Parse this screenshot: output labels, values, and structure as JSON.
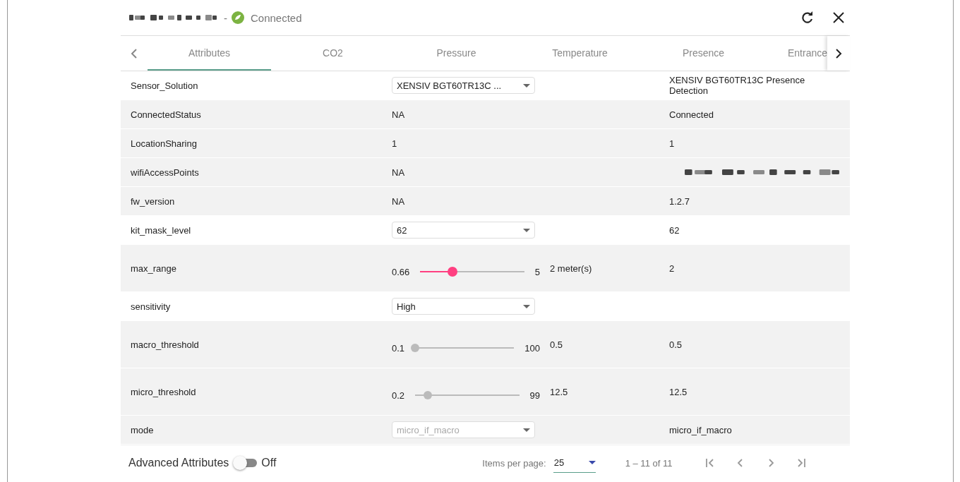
{
  "header": {
    "status": "Connected",
    "separator": "-"
  },
  "tabs": [
    {
      "label": "Attributes",
      "selected": true
    },
    {
      "label": "CO2",
      "selected": false
    },
    {
      "label": "Pressure",
      "selected": false
    },
    {
      "label": "Temperature",
      "selected": false
    },
    {
      "label": "Presence",
      "selected": false
    },
    {
      "label": "Entrance",
      "selected": false
    }
  ],
  "rows": [
    {
      "name": "Sensor_Solution",
      "kind": "select",
      "control": "XENSIV BGT60TR13C ...",
      "disabled": false,
      "value": "XENSIV BGT60TR13C Presence Detection"
    },
    {
      "name": "ConnectedStatus",
      "kind": "text",
      "control": "NA",
      "value": "Connected"
    },
    {
      "name": "LocationSharing",
      "kind": "text",
      "control": "1",
      "value": "1"
    },
    {
      "name": "wifiAccessPoints",
      "kind": "text",
      "control": "NA",
      "value_redacted": true
    },
    {
      "name": "fw_version",
      "kind": "text",
      "control": "NA",
      "value": "1.2.7"
    },
    {
      "name": "kit_mask_level",
      "kind": "select",
      "control": "62",
      "disabled": false,
      "value": "62"
    },
    {
      "name": "max_range",
      "kind": "slider",
      "min": "0.66",
      "max": "5",
      "level": 0.31,
      "disabled": false,
      "reading": "2 meter(s)",
      "value": "2"
    },
    {
      "name": "sensitivity",
      "kind": "select",
      "control": "High",
      "disabled": false
    },
    {
      "name": "macro_threshold",
      "kind": "slider",
      "min": "0.1",
      "max": "100",
      "level": 0,
      "disabled": true,
      "reading": "0.5",
      "value": "0.5"
    },
    {
      "name": "micro_threshold",
      "kind": "slider",
      "min": "0.2",
      "max": "99",
      "level": 0.12,
      "disabled": true,
      "reading": "12.5",
      "value": "12.5"
    },
    {
      "name": "mode",
      "kind": "select",
      "control": "micro_if_macro",
      "disabled": true,
      "value": "micro_if_macro"
    }
  ],
  "footer": {
    "advanced_label": "Advanced Attributes",
    "advanced_on": false,
    "advanced_state": "Off",
    "items_per_page_label": "Items per page:",
    "items_per_page": "25",
    "range": "1 – 11 of 11"
  }
}
